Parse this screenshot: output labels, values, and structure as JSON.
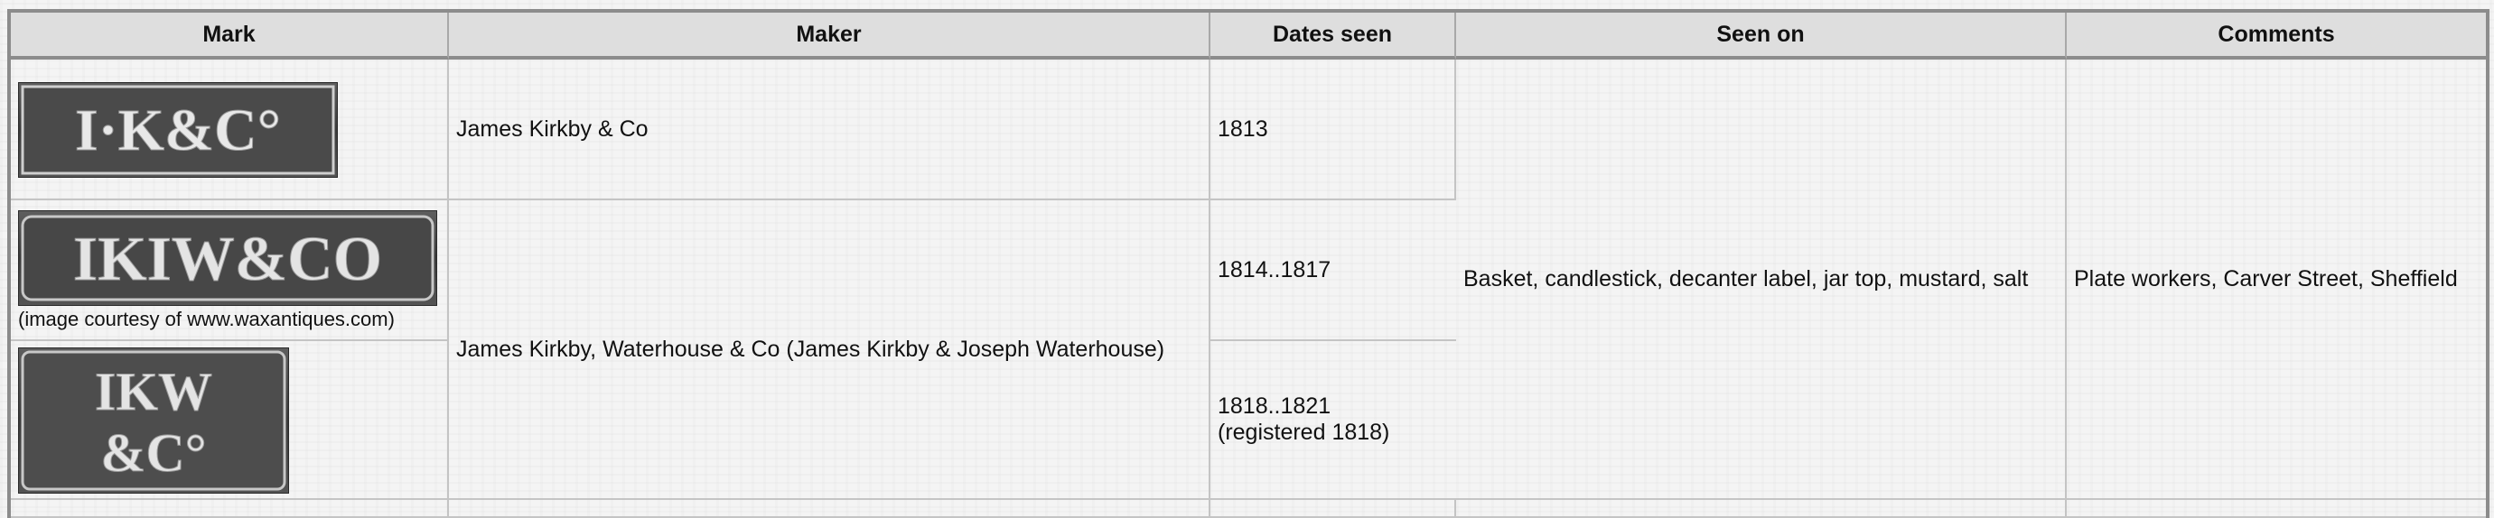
{
  "table": {
    "headers": {
      "mark": "Mark",
      "maker": "Maker",
      "dates": "Dates seen",
      "seen_on": "Seen on",
      "comments": "Comments"
    },
    "rows": [
      {
        "mark_icon": "hallmark-punch-ik-co-icon",
        "mark_text": "I·K&C°",
        "maker": "James Kirkby & Co",
        "dates": "1813"
      },
      {
        "mark_icon": "hallmark-punch-ikiwco-icon",
        "mark_text": "IKIW&CO",
        "mark_caption": "(image courtesy of www.waxantiques.com)",
        "dates": "1814..1817"
      },
      {
        "mark_icon": "hallmark-punch-ikw-co-icon",
        "mark_text_line1": "IKW",
        "mark_text_line2": "&C°",
        "dates_line1": "1818..1821",
        "dates_line2": "(registered 1818)"
      }
    ],
    "shared": {
      "maker_kirkby_waterhouse": "James Kirkby, Waterhouse & Co (James Kirkby & Joseph Waterhouse)",
      "seen_on": "Basket, candlestick, decanter label, jar top, mustard, salt",
      "comments": "Plate workers, Carver Street, Sheffield"
    }
  }
}
